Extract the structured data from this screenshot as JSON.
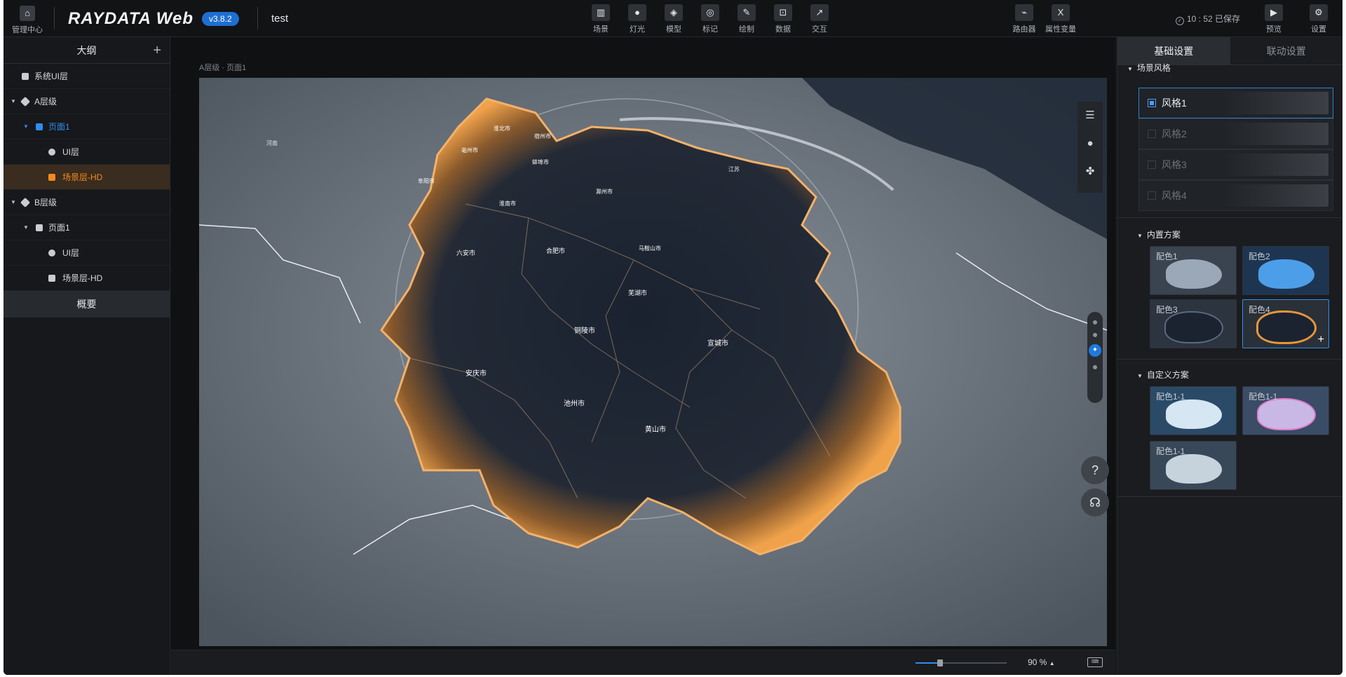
{
  "topbar": {
    "home_label": "管理中心",
    "home_icon": "home-icon",
    "app_name": "RAYDATA Web",
    "version": "v3.8.2",
    "project_name": "test",
    "tools": [
      {
        "label": "场景",
        "icon": "scene-icon"
      },
      {
        "label": "灯光",
        "icon": "light-icon"
      },
      {
        "label": "模型",
        "icon": "model-icon"
      },
      {
        "label": "标记",
        "icon": "marker-icon"
      },
      {
        "label": "绘制",
        "icon": "draw-icon"
      },
      {
        "label": "数据",
        "icon": "data-icon"
      },
      {
        "label": "交互",
        "icon": "interact-icon"
      }
    ],
    "right_tools": [
      {
        "label": "路由器",
        "icon": "router-icon"
      },
      {
        "label": "属性变量",
        "icon": "variable-icon"
      }
    ],
    "save_status": "10 : 52 已保存",
    "preview_label": "预览",
    "settings_label": "设置"
  },
  "outline": {
    "title": "大纲",
    "items": [
      {
        "label": "系统UI层"
      },
      {
        "label": "A层级"
      },
      {
        "label": "页面1"
      },
      {
        "label": "UI层"
      },
      {
        "label": "场景层-HD"
      },
      {
        "label": "B层级"
      },
      {
        "label": "页面1"
      },
      {
        "label": "UI层"
      },
      {
        "label": "场景层-HD"
      }
    ],
    "overview_label": "概要"
  },
  "canvas": {
    "breadcrumb": "A层级 · 页面1",
    "cities": [
      "淮北市",
      "宿州市",
      "亳州市",
      "阜阳市",
      "蚌埠市",
      "淮南市",
      "滁州市",
      "六安市",
      "合肥市",
      "马鞍山市",
      "芜湖市",
      "铜陵市",
      "安庆市",
      "宣城市",
      "池州市",
      "黄山市"
    ],
    "outer_labels": [
      "河南",
      "江苏"
    ],
    "accent_color": "#f0a24a"
  },
  "bottombar": {
    "zoom_value": "90 %",
    "zoom_fraction": 0.27
  },
  "inspector": {
    "tabs": [
      "基础设置",
      "联动设置"
    ],
    "scene_style_title": "场景风格",
    "styles": [
      "风格1",
      "风格2",
      "风格3",
      "风格4"
    ],
    "builtin_title": "内置方案",
    "builtin": [
      "配色1",
      "配色2",
      "配色3",
      "配色4"
    ],
    "custom_title": "自定义方案",
    "custom": [
      "配色1-1",
      "配色1-1",
      "配色1-1"
    ],
    "selected_color": "#2f8cf0"
  }
}
